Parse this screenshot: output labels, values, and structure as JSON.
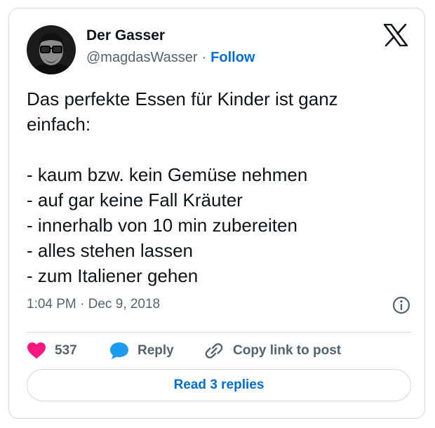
{
  "author": {
    "display_name": "Der Gasser",
    "handle": "@magdasWasser",
    "separator": "·",
    "follow_label": "Follow"
  },
  "tweet": {
    "lines": [
      "Das perfekte Essen für Kinder ist ganz",
      "einfach:",
      "",
      "- kaum bzw. kein Gemüse nehmen",
      "- auf gar keine Fall Kräuter",
      "- innerhalb von 10 min zubereiten",
      "- alles stehen lassen",
      "- zum Italiener gehen"
    ],
    "timestamp": "1:04 PM · Dec 9, 2018"
  },
  "actions": {
    "like_count": "537",
    "reply_label": "Reply",
    "copy_link_label": "Copy link to post"
  },
  "read_replies_label": "Read 3 replies",
  "icons": {
    "logo": "x-logo-icon",
    "info": "info-icon",
    "like": "heart-icon",
    "reply": "speech-bubble-icon",
    "copy": "link-icon"
  },
  "colors": {
    "like": "#f91880",
    "reply": "#1d9bf0",
    "link_blue": "#006fd6",
    "secondary_text": "#536471",
    "border": "#cfd9de"
  }
}
